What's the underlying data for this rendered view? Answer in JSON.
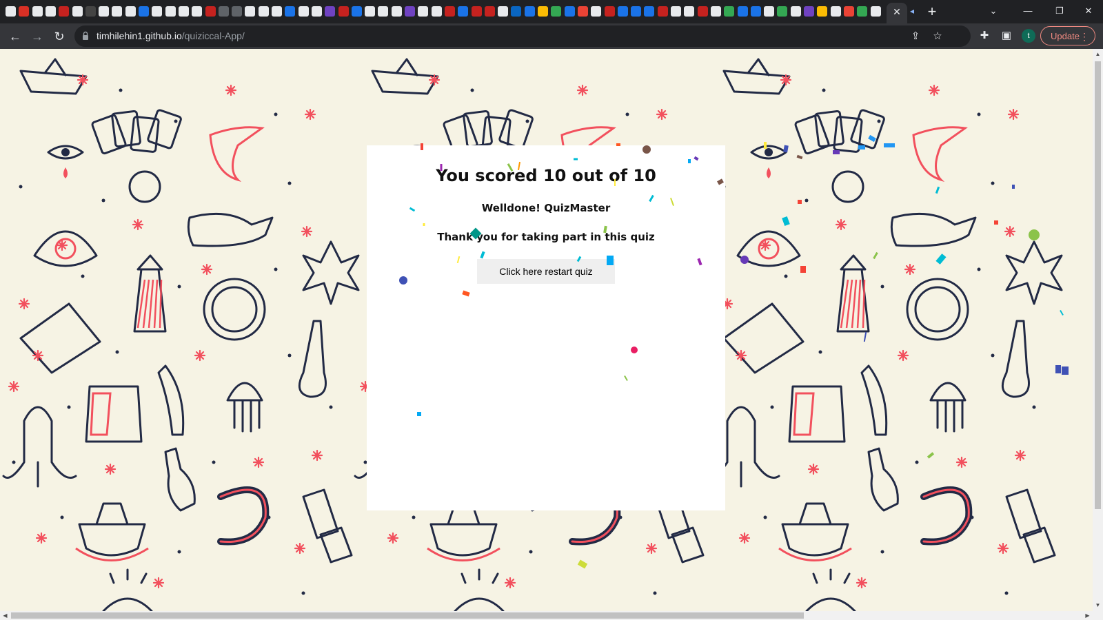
{
  "browser": {
    "url_host": "timhilehin1.github.io",
    "url_path": "/quiziccal-App/",
    "update_label": "Update",
    "profile_initial": "t",
    "tab_favicon_colors": [
      "#e8eaed",
      "#d93025",
      "#e8eaed",
      "#e8eaed",
      "#c5221f",
      "#e8eaed",
      "#444",
      "#e8eaed",
      "#e8eaed",
      "#e8eaed",
      "#1a73e8",
      "#e8eaed",
      "#e8eaed",
      "#e8eaed",
      "#e8eaed",
      "#c5221f",
      "#5f6368",
      "#5f6368",
      "#e8eaed",
      "#e8eaed",
      "#e8eaed",
      "#1a73e8",
      "#e8eaed",
      "#e8eaed",
      "#6f42c1",
      "#c5221f",
      "#1a73e8",
      "#e8eaed",
      "#e8eaed",
      "#e8eaed",
      "#6f42c1",
      "#e8eaed",
      "#e8eaed",
      "#c5221f",
      "#1a73e8",
      "#c5221f",
      "#c5221f",
      "#e8eaed",
      "#0a66c2",
      "#1a73e8",
      "#fbbc04",
      "#34a853",
      "#1a73e8",
      "#ea4335",
      "#e8eaed",
      "#c5221f",
      "#1a73e8",
      "#1a73e8",
      "#1a73e8",
      "#c5221f",
      "#e8eaed",
      "#e8eaed",
      "#c5221f",
      "#e8eaed",
      "#34a853",
      "#1a73e8",
      "#1a73e8",
      "#e8eaed",
      "#34a853",
      "#e8eaed",
      "#6f42c1",
      "#fbbc04",
      "#e8eaed",
      "#ea4335",
      "#34a853",
      "#e8eaed"
    ]
  },
  "quiz": {
    "score_text": "You scored 10 out of 10",
    "greeting": "Welldone! QuizMaster",
    "thanks": "Thank you for taking part in this quiz",
    "restart_label": "Click here restart quiz"
  },
  "colors": {
    "page_bg": "#f6f3e4",
    "pattern_stroke": "#222a45",
    "pattern_accent": "#f2505d",
    "card_bg": "#ffffff",
    "button_bg": "#efefef",
    "confetti": [
      "#e91e63",
      "#3f51b5",
      "#ff9800",
      "#00bcd4",
      "#8bc34a",
      "#9c27b0",
      "#ffeb3b",
      "#795548",
      "#03a9f4",
      "#f44336",
      "#009688",
      "#cddc39",
      "#673ab7",
      "#ff5722",
      "#2196f3"
    ]
  }
}
